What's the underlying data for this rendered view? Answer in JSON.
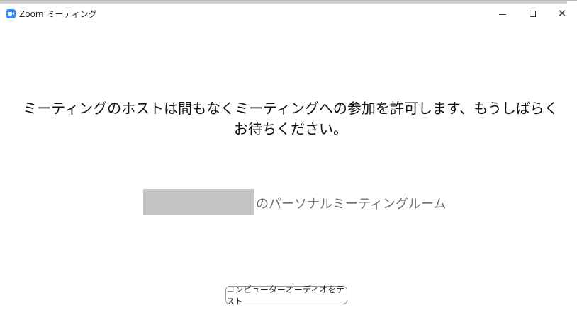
{
  "window": {
    "title": "Zoom ミーティング",
    "icon": "zoom-video-icon",
    "controls": {
      "minimize": "minimize-icon",
      "maximize": "maximize-icon",
      "close_glyph": "✕"
    }
  },
  "main": {
    "message": "ミーティングのホストは間もなくミーティングへの参加を許可します、もうしばらくお待ちください。",
    "room_label": "のパーソナルミーティングルーム",
    "test_audio_button": "コンピューターオーディオをテスト"
  },
  "colors": {
    "accent": "#2d8cff",
    "redaction": "#c4c4c4",
    "muted_text": "#6f6f6f"
  }
}
